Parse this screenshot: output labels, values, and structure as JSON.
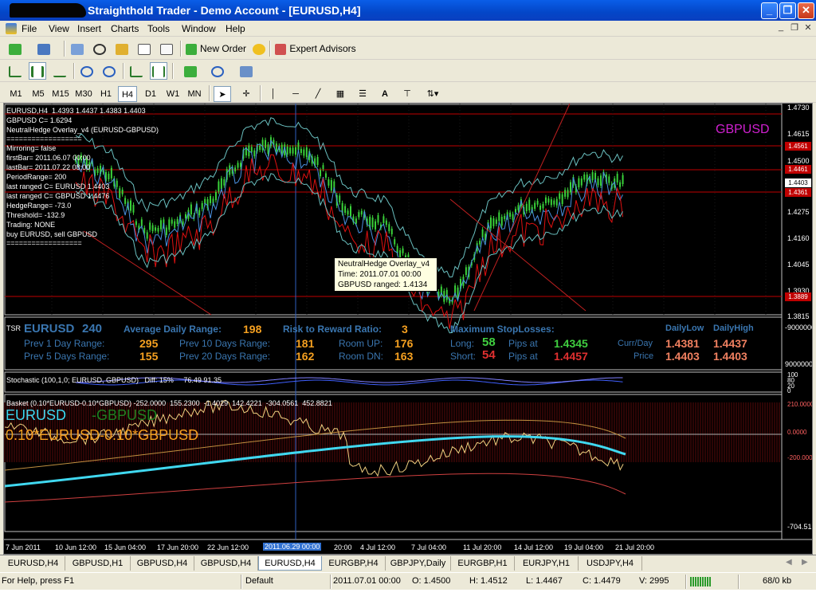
{
  "window": {
    "title": "Straighthold Trader - Demo Account - [EURUSD,H4]",
    "controls": [
      "_",
      "❐",
      "✕"
    ]
  },
  "menu": {
    "items": [
      "File",
      "View",
      "Insert",
      "Charts",
      "Tools",
      "Window",
      "Help"
    ],
    "mdi_controls": [
      "_",
      "❐",
      "✕"
    ]
  },
  "toolbar": {
    "new_order": "New Order",
    "expert_advisors": "Expert Advisors"
  },
  "timeframes": [
    "M1",
    "M5",
    "M15",
    "M30",
    "H1",
    "H4",
    "D1",
    "W1",
    "MN"
  ],
  "active_timeframe": "H4",
  "draw_tools": {
    "text_tool": "A"
  },
  "chart": {
    "header": "EURUSD,H4  1.4393 1.4437 1.4383 1.4403",
    "info_lines": [
      "GBPUSD C= 1.6294",
      "NeutralHedge Overlay_v4 (EURUSD-GBPUSD)",
      "==================",
      "Mirroring= false",
      "firstBar= 2011.06.07 00:00",
      "lastBar= 2011.07.22 08:00",
      "PeriodRange= 200",
      "last ranged C= EURUSD 1.4403",
      "last ranged C= GBPUSD 1.4476",
      "HedgeRange= -73.0",
      "Threshold= -132.9",
      "Trading: NONE",
      "buy EURUSD, sell GBPUSD",
      "=================="
    ],
    "overlay_symbol": "GBPUSD",
    "price_axis": [
      "1.4730",
      "1.4615",
      "1.4500",
      "1.4403",
      "1.4275",
      "1.4160",
      "1.4045",
      "1.3930",
      "1.3815"
    ],
    "price_badges": [
      {
        "value": "1.4561",
        "color": "#c00000"
      },
      {
        "value": "1.4461",
        "color": "#c00000"
      },
      {
        "value": "1.4403",
        "color": "#ffffff"
      },
      {
        "value": "1.4361",
        "color": "#c00000"
      },
      {
        "value": "1.3889",
        "color": "#c00000"
      }
    ],
    "tooltip": [
      "NeutralHedge Overlay_v4",
      "Time: 2011.07.01 00:00",
      "GBPUSD ranged: 1.4134"
    ]
  },
  "tsr": {
    "label": "TSR",
    "symbol": "EURUSD",
    "period": "240",
    "avg_daily_range_label": "Average Daily Range:",
    "avg_daily_range": "198",
    "rr_label": "Risk to Reward Ratio:",
    "rr": "3",
    "max_sl_label": "Maximum StopLosses:",
    "daily_low_label": "DailyLow",
    "daily_high_label": "DailyHigh",
    "prev1_label": "Prev 1 Day Range:",
    "prev1": "295",
    "prev5_label": "Prev 5 Days Range:",
    "prev5": "155",
    "prev10_label": "Prev 10 Days Range:",
    "prev10": "181",
    "prev20_label": "Prev 20 Days Range:",
    "prev20": "162",
    "room_up_label": "Room UP:",
    "room_up": "176",
    "room_dn_label": "Room DN:",
    "room_dn": "163",
    "long_label": "Long:",
    "long_sl": "58",
    "short_label": "Short:",
    "short_sl": "54",
    "pips_at": "Pips at",
    "long_price": "1.4345",
    "short_price": "1.4457",
    "currday_label": "Curr/Day",
    "price_label": "Price",
    "currday_low": "1.4381",
    "currday_high": "1.4437",
    "price_low": "1.4403",
    "price_high": "1.4403",
    "axis_top": "-9000000",
    "axis_bottom": "9000000"
  },
  "stochastic": {
    "header": "Stochastic (100,1,0; EURUSD, GBPUSD)   Diff: 15%     76.49 91.35",
    "axis": [
      "100",
      "80",
      "20",
      "0"
    ]
  },
  "basket": {
    "header": "Basket (0.10*EURUSD-0.10*GBPUSD) -252.0000  155.2300  -1.4029  142.4221  -304.0561  452.8821",
    "big_label_1": "EURUSD",
    "big_label_2": "-GBPUSD",
    "big_label_3": "0.10*EURUSD-0.10*GBPUSD",
    "axis": [
      "210.0000",
      "0.0000",
      "-200.0000",
      "-704.5177"
    ]
  },
  "time_axis": [
    "7 Jun 2011",
    "10 Jun 12:00",
    "15 Jun 04:00",
    "17 Jun 20:00",
    "22 Jun 12:00",
    "2011.06.29 00:00",
    "4 Jul 12:00",
    "7 Jul 04:00",
    "11 Jul 20:00",
    "14 Jul 12:00",
    "19 Jul 04:00",
    "21 Jul 20:00"
  ],
  "time_axis_partial": "20:00",
  "tabs": [
    "EURUSD,H4",
    "GBPUSD,H1",
    "GBPUSD,H4",
    "GBPUSD,H4",
    "EURUSD,H4",
    "EURGBP,H4",
    "GBPJPY,Daily",
    "EURGBP,H1",
    "EURJPY,H1",
    "USDJPY,H4"
  ],
  "active_tab": 4,
  "status": {
    "help": "For Help, press F1",
    "profile": "Default",
    "time": "2011.07.01 00:00",
    "open": "O: 1.4500",
    "high": "H: 1.4512",
    "low": "L: 1.4467",
    "close": "C: 1.4479",
    "volume": "V: 2995",
    "traffic": "68/0 kb"
  },
  "colors": {
    "candle": "#3ad23a",
    "overlay_label": "#d020d0",
    "hline": "#c00000",
    "blue_line": "#4a90e0",
    "red_line": "#e01010",
    "basket_line": "#f0d080",
    "cyan_line": "#40d8f0"
  }
}
